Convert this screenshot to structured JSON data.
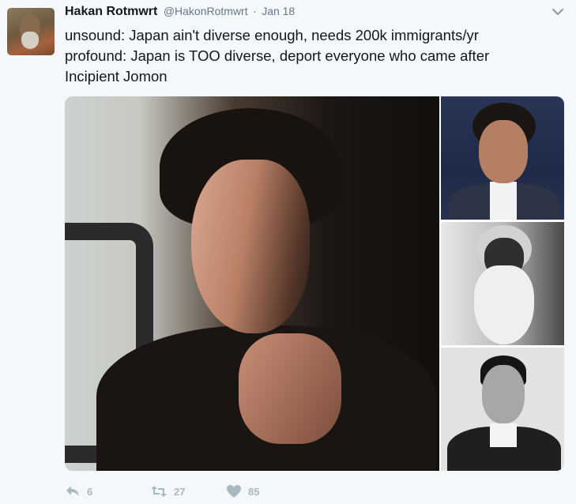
{
  "tweet": {
    "author_name": "Hakan Rotmwrt",
    "author_handle": "@HakonRotmwrt",
    "separator": "·",
    "timestamp": "Jan 18",
    "text_lines": [
      "unsound: Japan ain't diverse enough, needs 200k immigrants/yr",
      "profound: Japan is TOO diverse, deport everyone who came after",
      "Incipient Jomon"
    ],
    "actions": {
      "reply_count": "6",
      "retweet_count": "27",
      "like_count": "85"
    }
  },
  "icons": {
    "more": "chevron-down-icon",
    "reply": "reply-icon",
    "retweet": "retweet-icon",
    "like": "heart-icon"
  },
  "colors": {
    "background": "#f5f8fa",
    "text": "#14171a",
    "secondary_text": "#657786",
    "action_icon": "#aab8c2"
  }
}
